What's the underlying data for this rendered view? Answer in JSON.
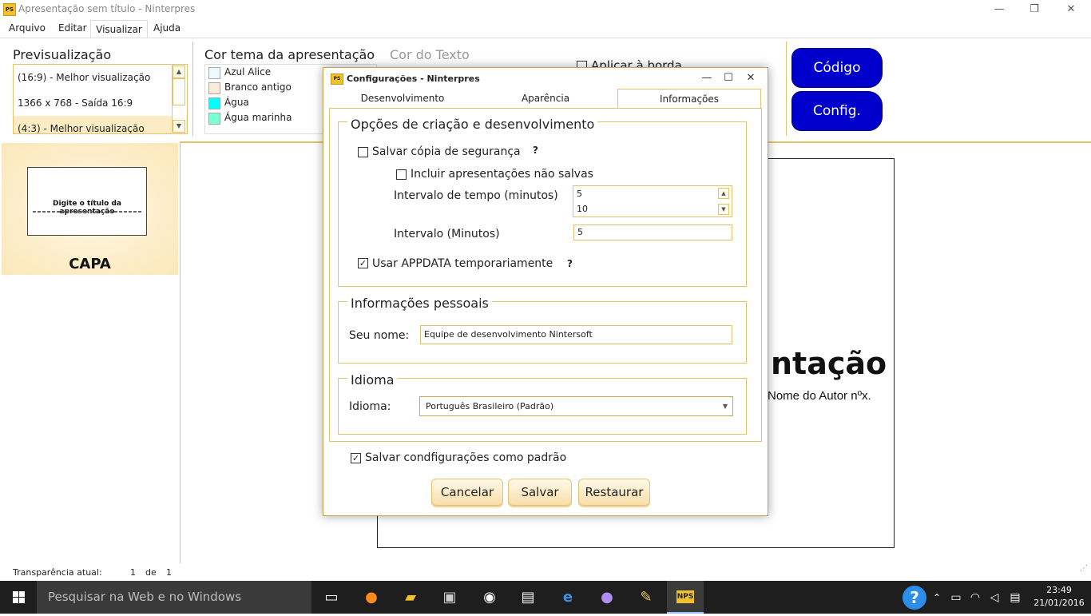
{
  "window": {
    "title": "Apresentação sem título - Ninterpres",
    "icon_text": "PS",
    "controls": [
      "—",
      "❐",
      "✕"
    ]
  },
  "menu": [
    "Arquivo",
    "Editar",
    "Visualizar",
    "Ajuda"
  ],
  "ribbon": {
    "preview": {
      "title": "Previsualização",
      "items": [
        "(16:9) - Melhor visualização",
        "1366 x 768 - Saída 16:9",
        "(4:3) - Melhor visualização"
      ]
    },
    "theme_color": {
      "title": "Cor tema da apresentação",
      "items": [
        {
          "label": "Azul Alice",
          "color": "#f0f8ff"
        },
        {
          "label": "Branco antigo",
          "color": "#faebd7"
        },
        {
          "label": "Água",
          "color": "#00ffff"
        },
        {
          "label": "Água marinha",
          "color": "#7fffd4"
        }
      ]
    },
    "text_color": {
      "title": "Cor do Texto"
    },
    "apply_border": "Aplicar à borda",
    "buttons": {
      "code": "Código",
      "config": "Config."
    }
  },
  "left_panel": {
    "thumb_title": "Digite o título da apresentação",
    "label": "CAPA"
  },
  "slide": {
    "title_fragment": "ntação",
    "author_fragment": "Nome do Autor nºx."
  },
  "status": {
    "label": "Transparência atual:",
    "current": "1",
    "of": "de",
    "total": "1"
  },
  "taskbar": {
    "search_placeholder": "Pesquisar na Web e no Windows",
    "time": "23:49",
    "date": "21/01/2016",
    "help": "?"
  },
  "dialog": {
    "title": "Configurações - Ninterpres",
    "tabs": [
      "Desenvolvimento",
      "Aparência",
      "Informações"
    ],
    "group_dev": {
      "legend": "Opções de criação e desenvolvimento",
      "backup": {
        "label": "Salvar cópia de segurança",
        "checked": false,
        "help": "?"
      },
      "include_unsaved": {
        "label": "Incluir apresentações não salvas",
        "checked": false
      },
      "interval_time_label": "Intervalo de tempo (minutos)",
      "interval_time_values": [
        "5",
        "10"
      ],
      "interval_label": "Intervalo (Minutos)",
      "interval_value": "5",
      "appdata": {
        "label": "Usar APPDATA temporariamente",
        "checked": true,
        "help": "?"
      }
    },
    "group_personal": {
      "legend": "Informações pessoais",
      "name_label": "Seu nome:",
      "name_value": "Equipe de desenvolvimento Nintersoft"
    },
    "group_lang": {
      "legend": "Idioma",
      "label": "Idioma:",
      "value": "Português  Brasileiro (Padrão)"
    },
    "save_default": {
      "label": "Salvar condfigurações como padrão",
      "checked": true
    },
    "buttons": {
      "cancel": "Cancelar",
      "save": "Salvar",
      "restore": "Restaurar"
    }
  }
}
